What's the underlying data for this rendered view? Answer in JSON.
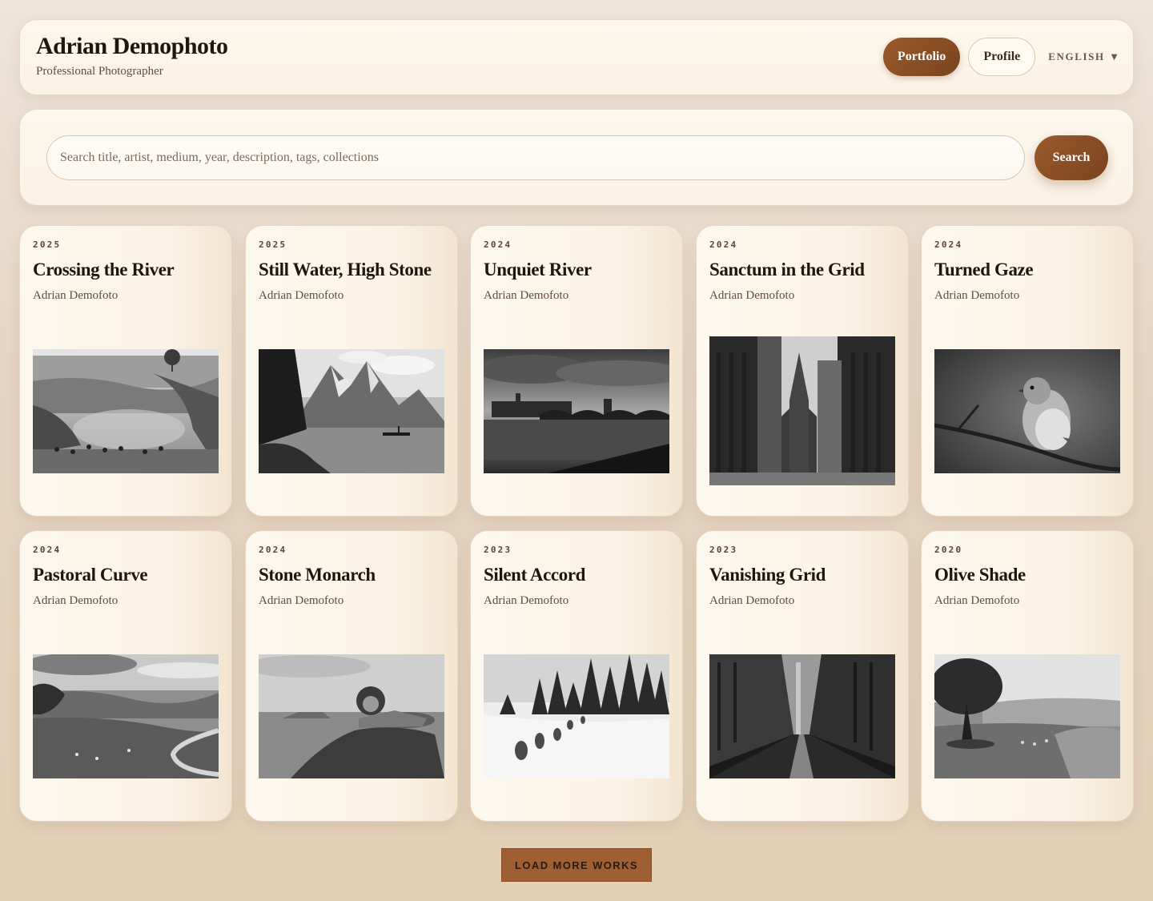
{
  "header": {
    "title": "Adrian Demophoto",
    "subtitle": "Professional Photographer",
    "nav": {
      "portfolio_label": "Portfolio",
      "profile_label": "Profile",
      "language_label": "ENGLISH",
      "language_icon": "chevron-down-icon"
    }
  },
  "search": {
    "placeholder": "Search title, artist, medium, year, description, tags, collections",
    "value": "",
    "button_label": "Search"
  },
  "works": [
    {
      "year": "2025",
      "title": "Crossing the River",
      "artist": "Adrian Demofoto",
      "scene": "herd-crossing-river"
    },
    {
      "year": "2025",
      "title": "Still Water, High Stone",
      "artist": "Adrian Demofoto",
      "scene": "mountain-lake-boat"
    },
    {
      "year": "2024",
      "title": "Unquiet River",
      "artist": "Adrian Demofoto",
      "scene": "city-river-bridge"
    },
    {
      "year": "2024",
      "title": "Sanctum in the Grid",
      "artist": "Adrian Demofoto",
      "scene": "cathedral-between-towers"
    },
    {
      "year": "2024",
      "title": "Turned Gaze",
      "artist": "Adrian Demofoto",
      "scene": "bird-on-branch"
    },
    {
      "year": "2024",
      "title": "Pastoral Curve",
      "artist": "Adrian Demofoto",
      "scene": "countryside-road"
    },
    {
      "year": "2024",
      "title": "Stone Monarch",
      "artist": "Adrian Demofoto",
      "scene": "lion-on-rock"
    },
    {
      "year": "2023",
      "title": "Silent Accord",
      "artist": "Adrian Demofoto",
      "scene": "wolves-in-snow"
    },
    {
      "year": "2023",
      "title": "Vanishing Grid",
      "artist": "Adrian Demofoto",
      "scene": "wet-city-street"
    },
    {
      "year": "2020",
      "title": "Olive Shade",
      "artist": "Adrian Demofoto",
      "scene": "olive-tree-hills"
    }
  ],
  "load_more_label": "LOAD MORE WORKS",
  "colors": {
    "accent": "#8a4e24",
    "panel": "#fcf6eb",
    "text": "#1f1610"
  }
}
